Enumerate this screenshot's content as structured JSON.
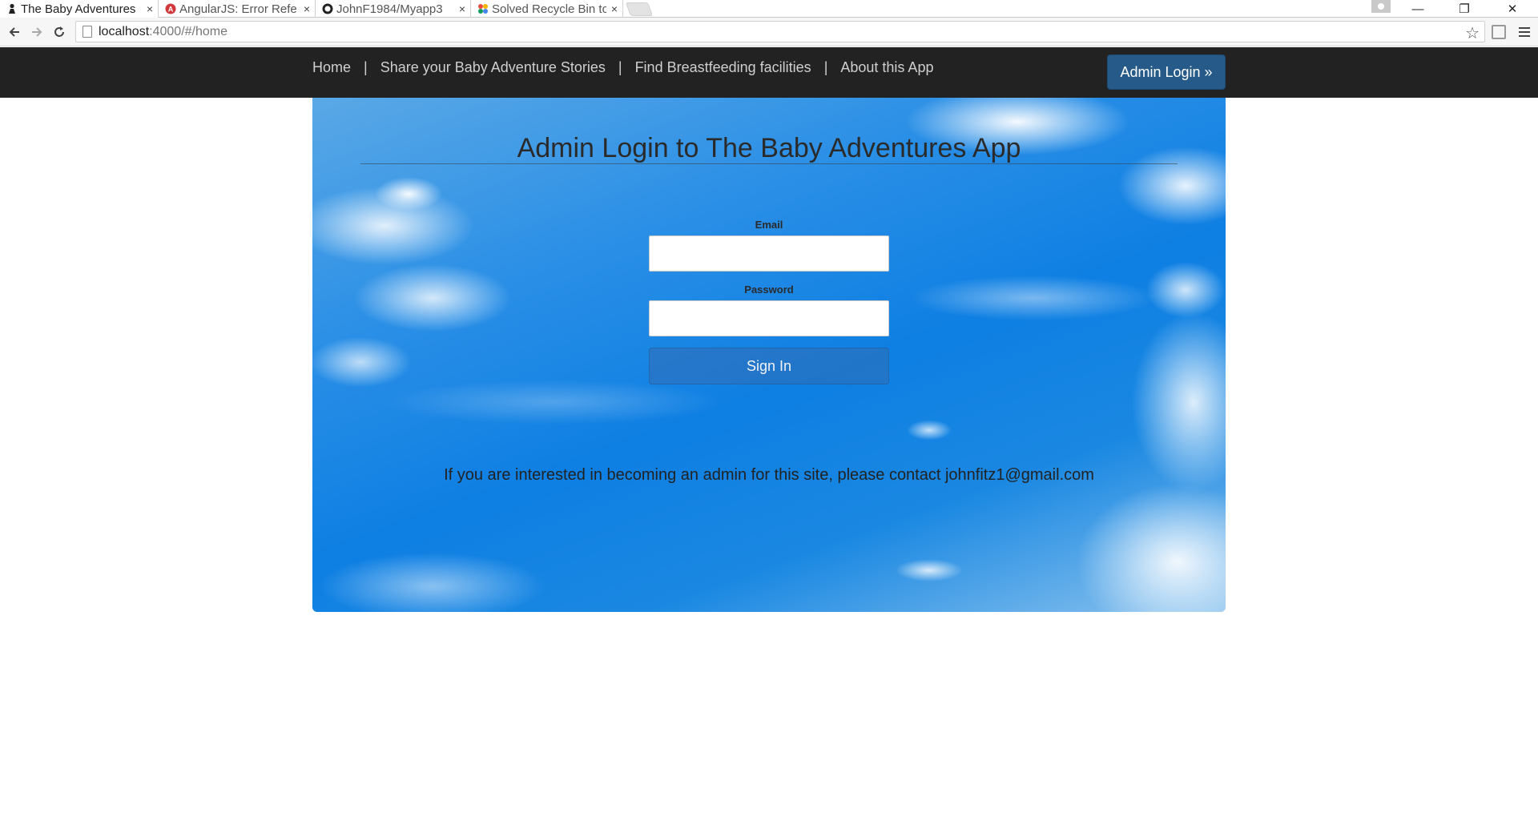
{
  "browser": {
    "tabs": [
      {
        "title": "The Baby Adventures",
        "favicon": "baby-icon",
        "active": true
      },
      {
        "title": "AngularJS: Error Refe",
        "favicon": "angular-icon",
        "active": false
      },
      {
        "title": "JohnF1984/Myapp3",
        "favicon": "github-icon",
        "active": false
      },
      {
        "title": "Solved Recycle Bin to",
        "favicon": "colorful-icon",
        "active": false
      }
    ],
    "close_glyph": "×",
    "window_controls": {
      "minimize": "—",
      "restore": "❐",
      "close": "✕"
    },
    "address": {
      "host": "localhost",
      "path": ":4000/#/home"
    },
    "star_glyph": "☆"
  },
  "navbar": {
    "links": [
      {
        "label": "Home"
      },
      {
        "label": "Share your Baby Adventure Stories"
      },
      {
        "label": "Find Breastfeeding facilities"
      },
      {
        "label": "About this App"
      }
    ],
    "separator": "|",
    "admin_button": "Admin Login »",
    "colors": {
      "bar": "#222222",
      "admin_button": "#265a88"
    }
  },
  "hero": {
    "title": "Admin Login to The Baby Adventures App",
    "email_label": "Email",
    "email_value": "",
    "password_label": "Password",
    "password_value": "",
    "signin_label": "Sign In",
    "contact_text": "If you are interested in becoming an admin for this site, please contact johnfitz1@gmail.com"
  }
}
